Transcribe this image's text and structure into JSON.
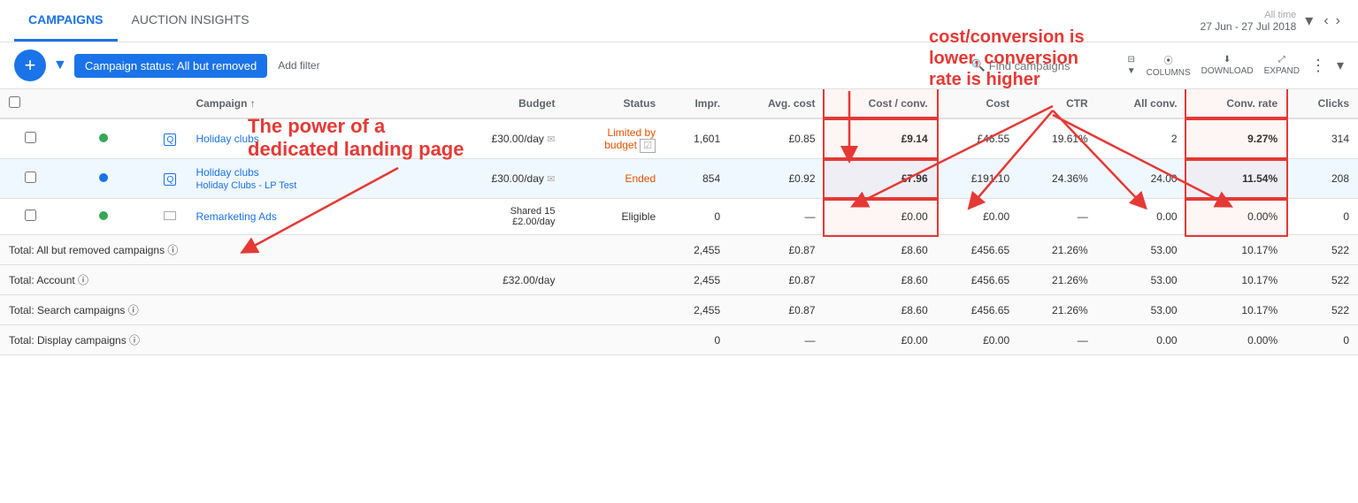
{
  "tabs": [
    {
      "id": "campaigns",
      "label": "CAMPAIGNS",
      "active": true
    },
    {
      "id": "auction",
      "label": "AUCTION INSIGHTS",
      "active": false
    }
  ],
  "date": {
    "range_label": "All time",
    "range": "27 Jun - 27 Jul 2018"
  },
  "toolbar": {
    "add_label": "+",
    "filter_label": "Campaign status: All but removed",
    "add_filter_label": "Add filter",
    "search_placeholder": "Find campaigns",
    "filter_icon": "▼",
    "columns_label": "COLUMNS",
    "download_label": "DOWNLOAD",
    "expand_label": "EXPAND",
    "more_label": "MORE"
  },
  "table": {
    "headers": [
      {
        "id": "checkbox",
        "label": ""
      },
      {
        "id": "status_dot",
        "label": ""
      },
      {
        "id": "campaign_type",
        "label": ""
      },
      {
        "id": "campaign",
        "label": "Campaign ↑"
      },
      {
        "id": "budget",
        "label": "Budget"
      },
      {
        "id": "status",
        "label": "Status"
      },
      {
        "id": "impr",
        "label": "Impr."
      },
      {
        "id": "avg_cost",
        "label": "Avg. cost"
      },
      {
        "id": "cost_conv",
        "label": "Cost / conv."
      },
      {
        "id": "cost",
        "label": "Cost"
      },
      {
        "id": "ctr",
        "label": "CTR"
      },
      {
        "id": "all_conv",
        "label": "All conv."
      },
      {
        "id": "conv_rate",
        "label": "Conv. rate"
      },
      {
        "id": "clicks",
        "label": "Clicks"
      }
    ],
    "rows": [
      {
        "id": "row1",
        "checkbox": false,
        "dot": "green",
        "type": "search",
        "name": "Holiday clubs",
        "sub_name": "",
        "budget": "£30.00/day",
        "budget_icon": true,
        "status": "Limited by budget",
        "status_type": "limited",
        "status_icon": true,
        "impr": "1,601",
        "avg_cost": "£0.85",
        "cost_conv": "£9.14",
        "cost": "£46.55",
        "ctr": "19.61%",
        "all_conv": "2",
        "conv_rate": "9.27%",
        "clicks": "314"
      },
      {
        "id": "row2",
        "checkbox": false,
        "dot": "blue",
        "type": "search",
        "name": "Holiday clubs",
        "sub_name": "Holiday Clubs - LP Test",
        "budget": "£30.00/day",
        "budget_icon": true,
        "status": "Ended",
        "status_type": "ended",
        "status_icon": false,
        "impr": "854",
        "avg_cost": "£0.92",
        "cost_conv": "£7.96",
        "cost": "£191.10",
        "ctr": "24.36%",
        "all_conv": "24.00",
        "conv_rate": "11.54%",
        "clicks": "208"
      },
      {
        "id": "row3",
        "checkbox": false,
        "dot": "green",
        "type": "display",
        "name": "Remarketing Ads",
        "sub_name": "",
        "budget": "Shared 15 £2.00/day",
        "budget_icon": false,
        "status": "Eligible",
        "status_type": "eligible",
        "status_icon": false,
        "impr": "0",
        "avg_cost": "—",
        "cost_conv": "£0.00",
        "cost": "£0.00",
        "ctr": "—",
        "all_conv": "0.00",
        "conv_rate": "0.00%",
        "clicks": "0"
      }
    ],
    "totals": [
      {
        "label": "Total: All but removed campaigns ⓘ",
        "budget": "",
        "status": "",
        "impr": "2,455",
        "avg_cost": "£0.87",
        "cost_conv": "£8.60",
        "cost": "£456.65",
        "ctr": "21.26%",
        "all_conv": "53.00",
        "conv_rate": "10.17%",
        "clicks": "522"
      },
      {
        "label": "Total: Account ⓘ",
        "budget": "£32.00/day",
        "status": "",
        "impr": "2,455",
        "avg_cost": "£0.87",
        "cost_conv": "£8.60",
        "cost": "£456.65",
        "ctr": "21.26%",
        "all_conv": "53.00",
        "conv_rate": "10.17%",
        "clicks": "522"
      },
      {
        "label": "Total: Search campaigns ⓘ",
        "budget": "",
        "status": "",
        "impr": "2,455",
        "avg_cost": "£0.87",
        "cost_conv": "£8.60",
        "cost": "£456.65",
        "ctr": "21.26%",
        "all_conv": "53.00",
        "conv_rate": "10.17%",
        "clicks": "522"
      },
      {
        "label": "Total: Display campaigns ⓘ",
        "budget": "",
        "status": "",
        "impr": "0",
        "avg_cost": "—",
        "cost_conv": "£0.00",
        "cost": "£0.00",
        "ctr": "—",
        "all_conv": "0.00",
        "conv_rate": "0.00%",
        "clicks": "0"
      }
    ]
  },
  "annotations": {
    "text1": "The power of a\ndedicated landing page",
    "text2": "cost/conversion is\nlower, conversion\nrate is higher"
  }
}
